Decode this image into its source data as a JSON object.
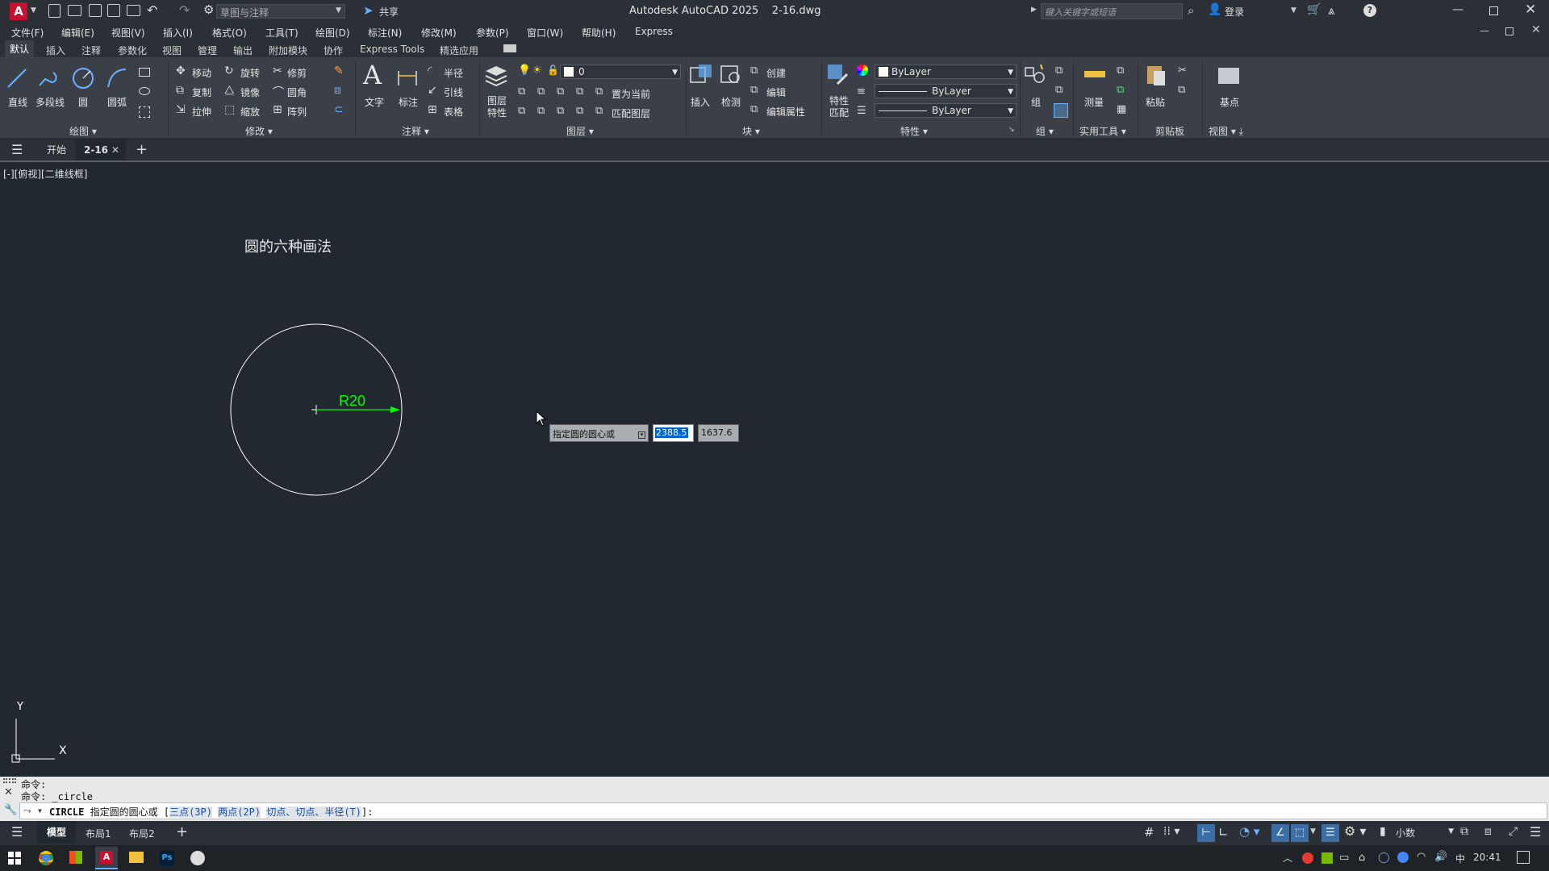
{
  "title": {
    "app": "Autodesk AutoCAD 2025",
    "file": "2-16.dwg",
    "workspace": "草图与注释",
    "share": "共享",
    "search_placeholder": "键入关键字或短语",
    "login": "登录"
  },
  "menu": [
    "文件(F)",
    "编辑(E)",
    "视图(V)",
    "插入(I)",
    "格式(O)",
    "工具(T)",
    "绘图(D)",
    "标注(N)",
    "修改(M)",
    "参数(P)",
    "窗口(W)",
    "帮助(H)",
    "Express"
  ],
  "ribbon_tabs": [
    "默认",
    "插入",
    "注释",
    "参数化",
    "视图",
    "管理",
    "输出",
    "附加模块",
    "协作",
    "Express Tools",
    "精选应用"
  ],
  "ribbon": {
    "draw": {
      "title": "绘图",
      "items": [
        "直线",
        "多段线",
        "圆",
        "圆弧"
      ]
    },
    "modify": {
      "title": "修改",
      "items": [
        "移动",
        "旋转",
        "修剪",
        "复制",
        "镜像",
        "圆角",
        "拉伸",
        "缩放",
        "阵列"
      ]
    },
    "annotation": {
      "title": "注释",
      "items": [
        "文字",
        "标注",
        "半径",
        "引线",
        "表格"
      ]
    },
    "layers": {
      "title": "图层",
      "layer_props": "图层\n特性",
      "current_layer": "0",
      "set_current": "置为当前",
      "match_layer": "匹配图层"
    },
    "block": {
      "title": "块",
      "insert": "插入",
      "detect": "检测",
      "create": "创建",
      "edit": "编辑",
      "edit_attr": "编辑属性"
    },
    "properties": {
      "title": "特性",
      "match": "特性\n匹配",
      "color": "ByLayer",
      "linetype": "ByLayer",
      "lineweight": "ByLayer"
    },
    "groups": {
      "title": "组",
      "group": "组"
    },
    "utilities": {
      "title": "实用工具",
      "measure": "测量"
    },
    "clipboard": {
      "title": "剪贴板",
      "paste": "粘贴"
    },
    "view": {
      "title": "视图",
      "base": "基点"
    }
  },
  "file_tabs": {
    "start": "开始",
    "current": "2-16"
  },
  "viewport": {
    "label": "[-][俯视][二维线框]",
    "drawing_title": "圆的六种画法",
    "dimension": "R20",
    "tooltip_prompt": "指定圆的圆心或",
    "x_value": "2388.5",
    "y_value": "1637.6",
    "ucs_x": "X",
    "ucs_y": "Y"
  },
  "command": {
    "history": [
      "命令:",
      "命令: _circle"
    ],
    "prompt_cmd": "CIRCLE",
    "prompt_text": "指定圆的圆心或",
    "options": [
      "三点(3P)",
      "两点(2P)",
      "切点、切点、半径(T)"
    ],
    "prompt_suffix": ":"
  },
  "layout_tabs": [
    "模型",
    "布局1",
    "布局2"
  ],
  "status": {
    "units": "小数"
  },
  "taskbar": {
    "time": "20:41",
    "ime": "中"
  },
  "colors": {
    "accent_green": "#00ff00",
    "circle": "#ffffff",
    "bg": "#212830",
    "select_blue": "#0066cc"
  }
}
